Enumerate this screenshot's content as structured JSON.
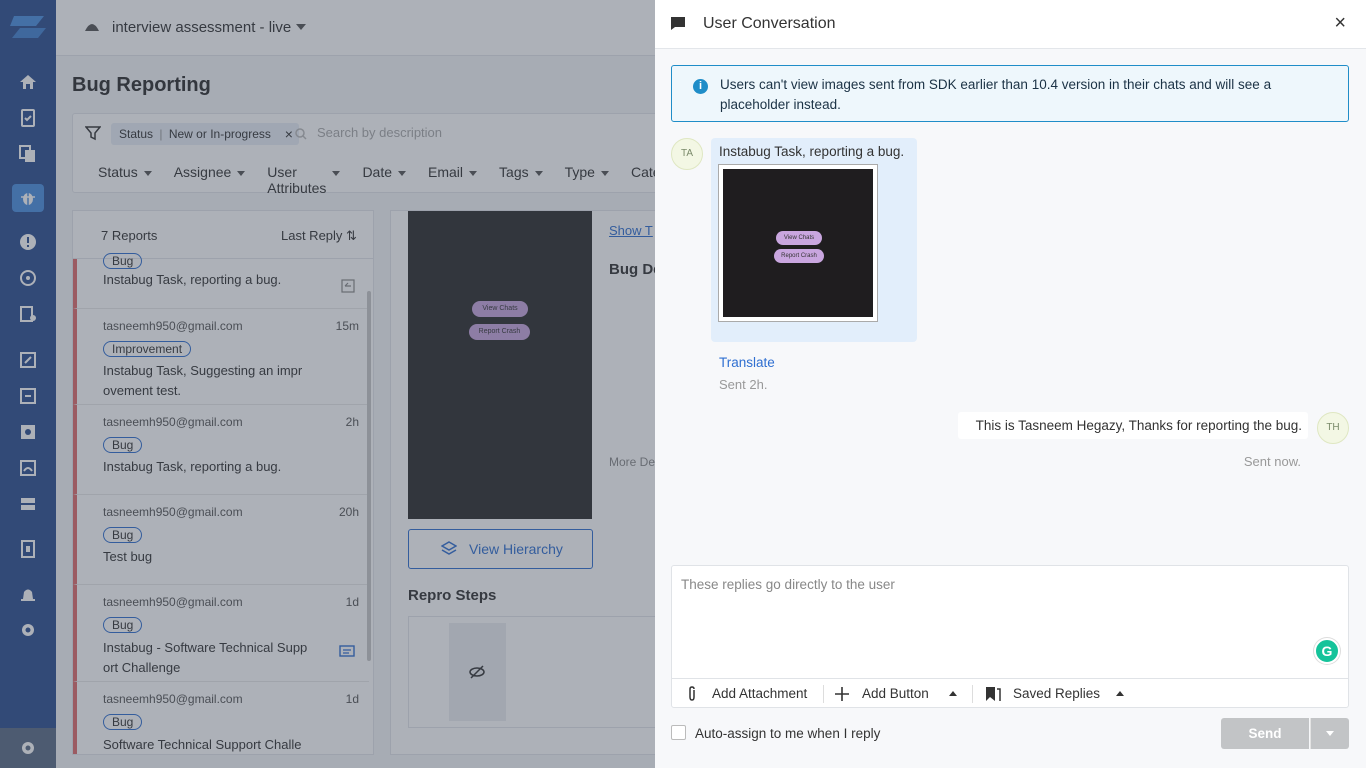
{
  "topbar": {
    "app_name": "interview assessment - live"
  },
  "page": {
    "title": "Bug Reporting"
  },
  "filters": {
    "chip_label": "Status",
    "chip_value": "New or In-progress",
    "search_placeholder": "Search by description",
    "items": [
      "Status",
      "Assignee",
      "User Attributes",
      "Date",
      "Email",
      "Tags",
      "Type",
      "Catego"
    ]
  },
  "list": {
    "count": "7 Reports",
    "sort_label": "Last Reply",
    "rows": [
      {
        "email": "",
        "time": "",
        "tag": "Bug",
        "text": "Instabug Task, reporting a bug."
      },
      {
        "email": "tasneemh950@gmail.com",
        "time": "15m",
        "tag": "Improvement",
        "text": "Instabug Task, Suggesting an impr ovement test."
      },
      {
        "email": "tasneemh950@gmail.com",
        "time": "2h",
        "tag": "Bug",
        "text": "Instabug Task, reporting a bug."
      },
      {
        "email": "tasneemh950@gmail.com",
        "time": "20h",
        "tag": "Bug",
        "text": "Test bug"
      },
      {
        "email": "tasneemh950@gmail.com",
        "time": "1d",
        "tag": "Bug",
        "text": "Instabug - Software Technical Supp ort Challenge"
      },
      {
        "email": "tasneemh950@gmail.com",
        "time": "1d",
        "tag": "Bug",
        "text": "Software Technical Support Challe"
      }
    ]
  },
  "detail": {
    "view_chats": "View Chats",
    "report_crash": "Report Crash",
    "view_hierarchy": "View Hierarchy",
    "repro_steps": "Repro Steps",
    "show_t": "Show T",
    "bug_de": "Bug De",
    "more_de": "More De"
  },
  "panel": {
    "title": "User Conversation",
    "notice": "Users can't view images sent from SDK earlier than 10.4 version in their chats and will see a placeholder instead.",
    "messages": {
      "in_avatar": "TA",
      "in_text": "Instabug Task, reporting a bug.",
      "img_btn1": "View Chats",
      "img_btn2": "Report Crash",
      "translate": "Translate",
      "in_sent": "Sent 2h.",
      "out_avatar": "TH",
      "out_text": "This is Tasneem Hegazy, Thanks for reporting the bug.",
      "out_sent": "Sent now."
    },
    "composer": {
      "placeholder": "These replies go directly to the user",
      "add_attachment": "Add Attachment",
      "add_button": "Add Button",
      "saved_replies": "Saved Replies"
    },
    "auto_assign": "Auto-assign to me when I reply",
    "send": "Send"
  }
}
